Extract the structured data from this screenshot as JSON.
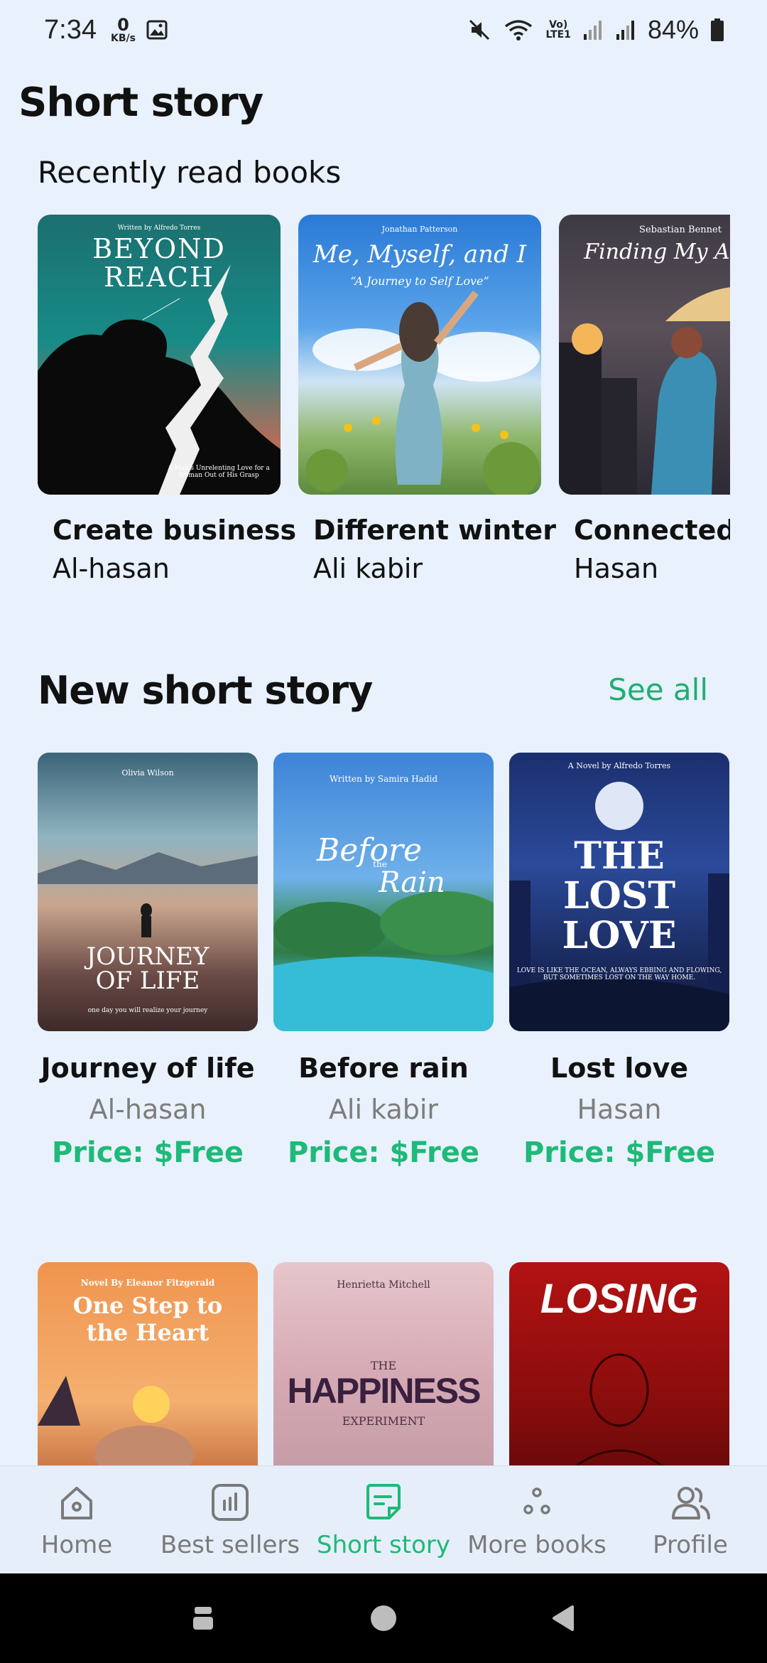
{
  "status_bar": {
    "time": "7:34",
    "net_speed_value": "0",
    "net_speed_unit": "KB/s",
    "volte": "Vo)",
    "lte": "LTE1",
    "battery": "84%"
  },
  "page_title": "Short story",
  "recent": {
    "heading": "Recently read books",
    "items": [
      {
        "title": "Create business",
        "author": "Al-hasan",
        "cover": {
          "top": "Written by Alfredo Torres",
          "main": "BEYOND REACH",
          "bottom": "A Man's Unrelenting Love for a Woman Out of His Grasp"
        }
      },
      {
        "title": "Different winter",
        "author": "Ali kabir",
        "cover": {
          "top": "Jonathan Patterson",
          "main": "Me, Myself, and I",
          "sub": "“A Journey to Self Love”"
        }
      },
      {
        "title": "Connected w",
        "author": "Hasan",
        "cover": {
          "top": "Sebastian Bennet",
          "main": "Finding My Again"
        }
      }
    ]
  },
  "new_stories": {
    "heading": "New short story",
    "see_all": "See all",
    "items": [
      {
        "title": "Journey of life",
        "author": "Al-hasan",
        "price": "Price: $Free",
        "cover": {
          "top": "Olivia Wilson",
          "main": "JOURNEY OF LIFE",
          "bottom": "one day you will realize your journey"
        }
      },
      {
        "title": "Before rain",
        "author": "Ali kabir",
        "price": "Price: $Free",
        "cover": {
          "top": "Written by Samira Hadid",
          "main": "Before",
          "the": "the",
          "main2": "Rain"
        }
      },
      {
        "title": "Lost love",
        "author": "Hasan",
        "price": "Price: $Free",
        "cover": {
          "top": "A Novel by Alfredo Torres",
          "main": "THE LOST LOVE",
          "bottom": "LOVE IS LIKE THE OCEAN, ALWAYS EBBING AND FLOWING, BUT SOMETIMES LOST ON THE WAY HOME."
        }
      }
    ],
    "more_covers": [
      {
        "top": "Novel By Eleanor Fitzgerald",
        "main": "One Step to the Heart"
      },
      {
        "top": "Henrietta Mitchell",
        "the": "THE",
        "main": "HAPPINESS",
        "bottom": "EXPERIMENT"
      },
      {
        "main": "LOSING"
      }
    ]
  },
  "bottom_nav": {
    "items": [
      {
        "label": "Home",
        "icon": "home-icon"
      },
      {
        "label": "Best sellers",
        "icon": "bar-chart-icon"
      },
      {
        "label": "Short story",
        "icon": "note-icon"
      },
      {
        "label": "More books",
        "icon": "dots-icon"
      },
      {
        "label": "Profile",
        "icon": "users-icon"
      }
    ],
    "active": "Short story"
  },
  "colors": {
    "accent": "#1fb978",
    "background": "#e8f1fc"
  }
}
